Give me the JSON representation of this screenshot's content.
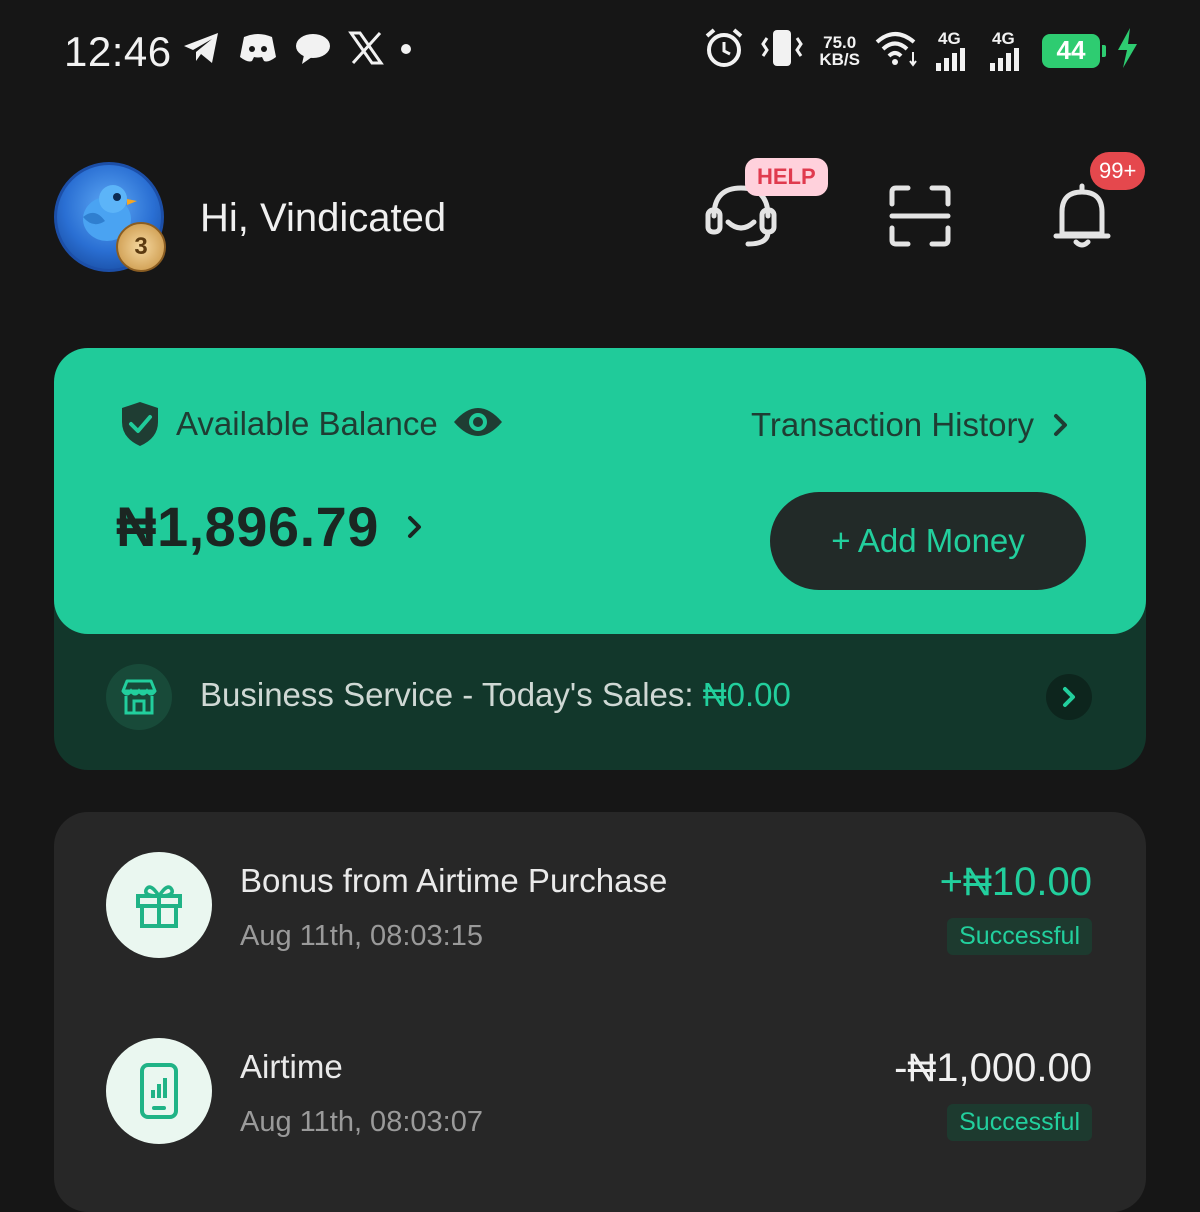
{
  "status_bar": {
    "time": "12:46",
    "net_speed_value": "75.0",
    "net_speed_unit": "KB/S",
    "sim1_label": "4G",
    "sim2_label": "4G",
    "battery": "44",
    "icons": [
      "telegram-icon",
      "discord-icon",
      "chat-bubble-icon",
      "x-icon",
      "dot-icon",
      "alarm-icon",
      "vibrate-icon",
      "wifi-icon",
      "signal-icon",
      "charging-icon"
    ]
  },
  "header": {
    "greeting": "Hi, Vindicated",
    "avatar_level": "3",
    "help_badge": "HELP",
    "notifications_badge": "99+"
  },
  "balance": {
    "label": "Available Balance",
    "amount": "₦1,896.79",
    "transaction_history_label": "Transaction History",
    "add_money_label": "+ Add Money"
  },
  "business": {
    "label": "Business Service - Today's Sales: ",
    "amount": "₦0.00"
  },
  "transactions": [
    {
      "title": "Bonus from Airtime Purchase",
      "date": "Aug 11th, 08:03:15",
      "amount": "+₦10.00",
      "status": "Successful",
      "icon": "gift-icon"
    },
    {
      "title": "Airtime",
      "date": "Aug 11th, 08:03:07",
      "amount": "-₦1,000.00",
      "status": "Successful",
      "icon": "phone-icon"
    }
  ],
  "colors": {
    "accent": "#20cb9a",
    "background": "#161616",
    "card": "#272727",
    "business_bar": "#12372b"
  }
}
